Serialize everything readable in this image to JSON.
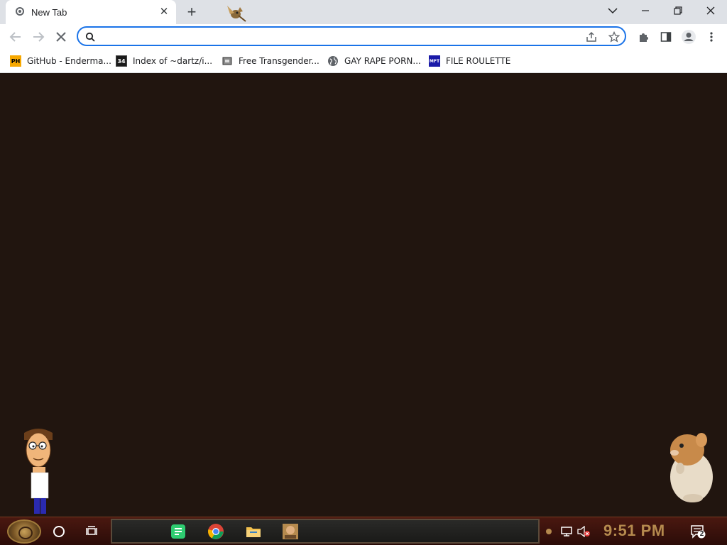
{
  "browser": {
    "tab": {
      "title": "New Tab",
      "close_icon": "close-icon",
      "favicon": "new-tab-favicon"
    },
    "new_tab_symbol": "+",
    "window_controls": [
      "chevron-down-icon",
      "minimize-icon",
      "restore-icon",
      "close-icon"
    ]
  },
  "toolbar": {
    "back_icon": "back-arrow-icon",
    "forward_icon": "forward-arrow-icon",
    "reload_icon": "stop-loading-icon",
    "address": {
      "value": "",
      "placeholder": ""
    },
    "share_icon": "share-icon",
    "bookmark_icon": "star-icon",
    "extensions_icon": "puzzle-icon",
    "side_panel_icon": "side-panel-icon",
    "profile_icon": "profile-icon",
    "menu_icon": "more-vert-icon"
  },
  "bookmarks": [
    {
      "label": "GitHub - Enderma...",
      "icon_text": "PH"
    },
    {
      "label": "Index of ~dartz/i...",
      "icon_text": "34"
    },
    {
      "label": "Free Transgender...",
      "icon_text": ""
    },
    {
      "label": "GAY RAPE PORN...",
      "icon_text": ""
    },
    {
      "label": "FILE ROULETTE",
      "icon_text": "MFT"
    }
  ],
  "taskbar": {
    "clock": "9:51 PM",
    "notification_count": "2",
    "pinned_apps": [
      "notes-app-icon",
      "chrome-icon",
      "file-explorer-icon",
      "game-app-icon"
    ]
  },
  "colors": {
    "desktop_bg": "#21150f",
    "accent": "#1a73e8",
    "clock": "#b58a4e"
  }
}
